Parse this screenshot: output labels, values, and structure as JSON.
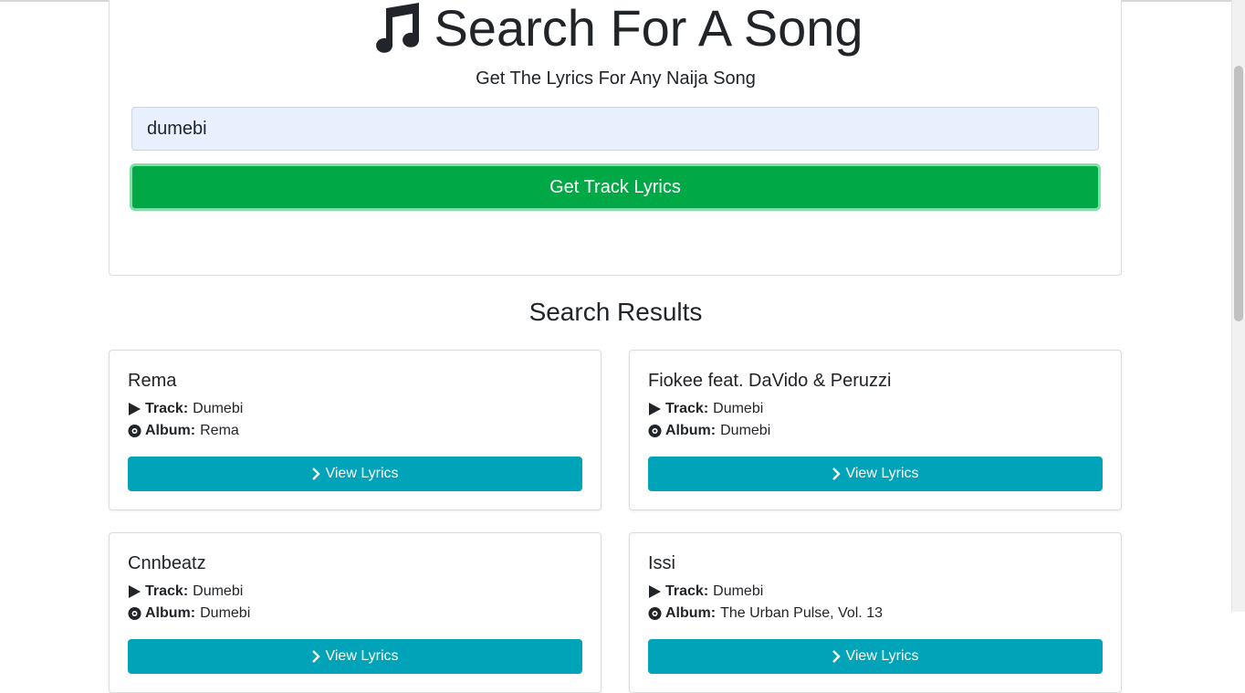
{
  "header": {
    "title": "Search For A Song",
    "subtitle": "Get The Lyrics For Any Naija Song"
  },
  "search": {
    "value": "dumebi",
    "button_label": "Get Track Lyrics"
  },
  "results": {
    "heading": "Search Results",
    "track_label": "Track:",
    "album_label": "Album:",
    "button_label": "View Lyrics",
    "items": [
      {
        "artist": "Rema",
        "track": "Dumebi",
        "album": "Rema"
      },
      {
        "artist": "Fiokee feat. DaVido & Peruzzi",
        "track": "Dumebi",
        "album": "Dumebi"
      },
      {
        "artist": "Cnnbeatz",
        "track": "Dumebi",
        "album": "Dumebi"
      },
      {
        "artist": "Issi",
        "track": "Dumebi",
        "album": "The Urban Pulse, Vol. 13"
      }
    ]
  },
  "colors": {
    "primary_button": "#00a846",
    "info_button": "#00a3b8",
    "input_bg": "#e8f0fe"
  },
  "icons": {
    "title_icon": "music-note-icon",
    "track_icon": "play-icon",
    "album_icon": "compact-disc-icon",
    "button_icon": "chevron-right-icon"
  }
}
